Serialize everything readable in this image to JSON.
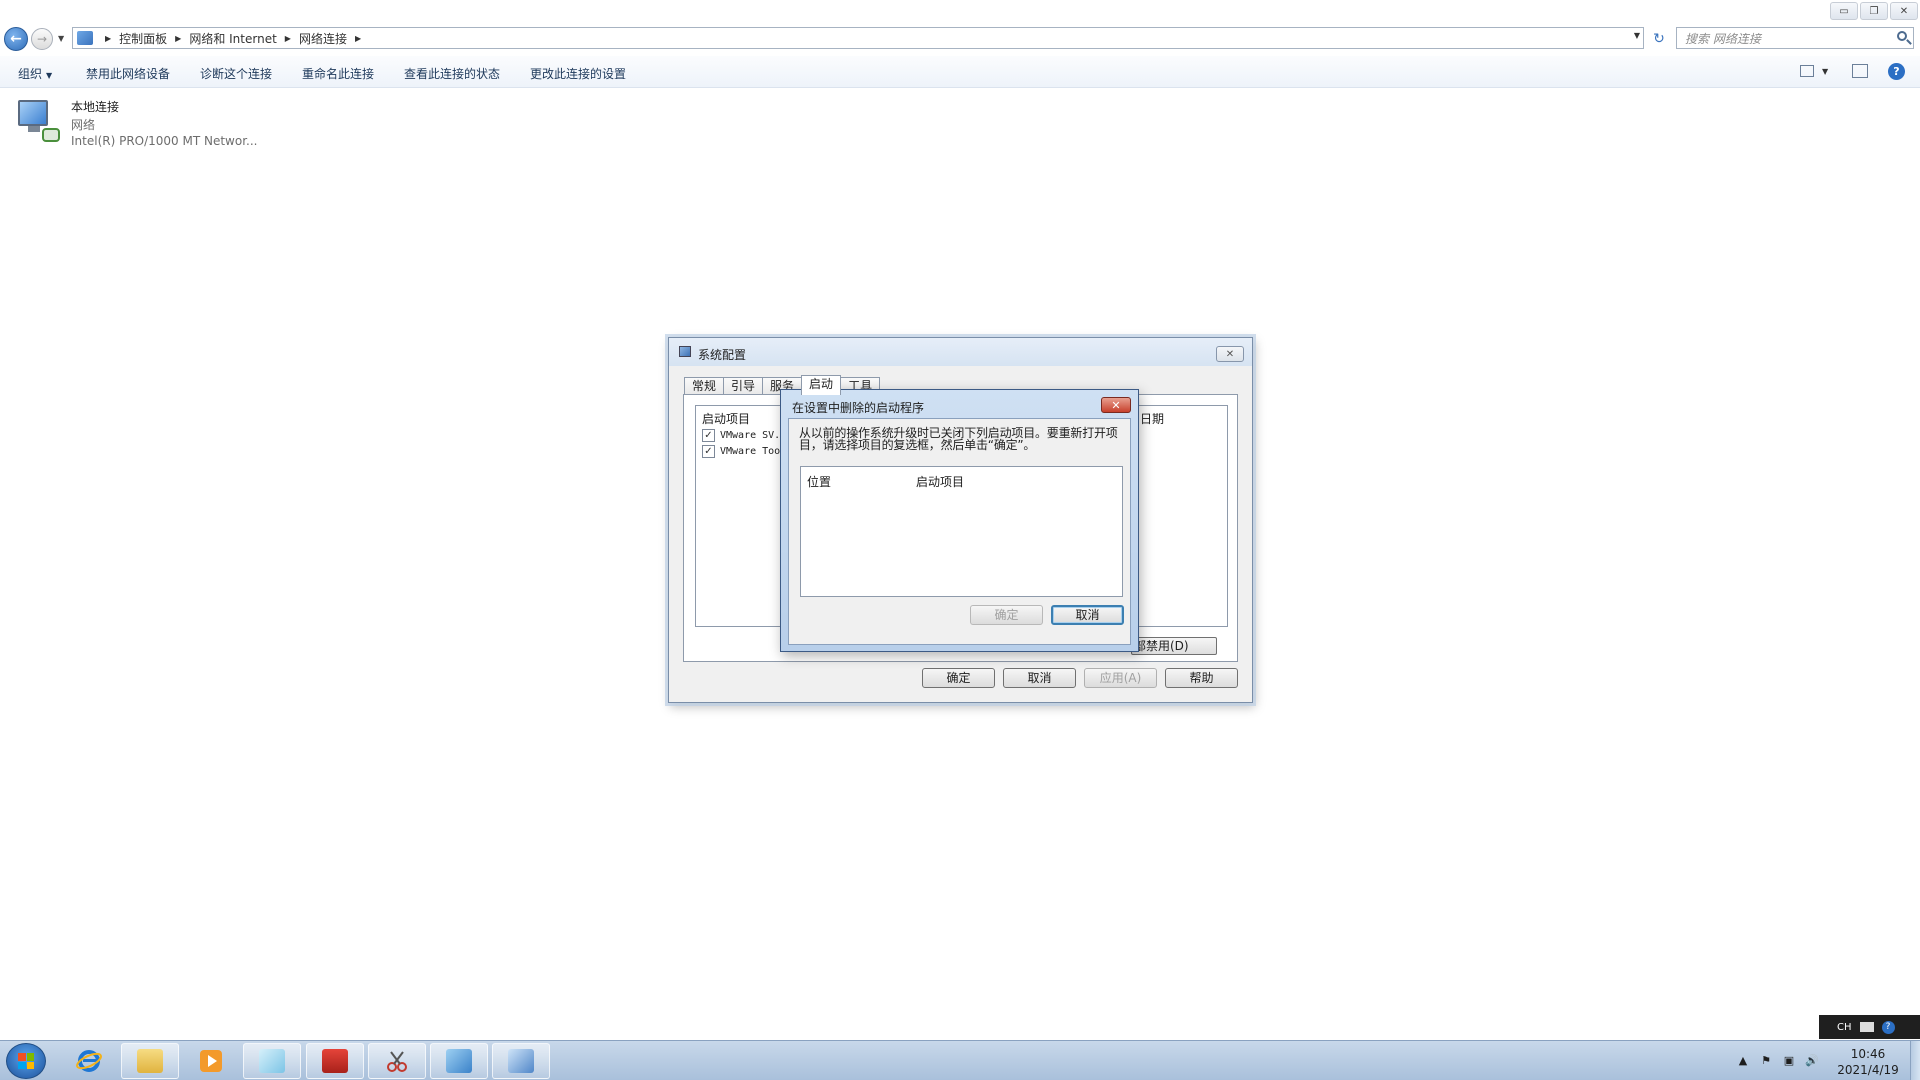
{
  "explorer": {
    "caption_buttons": {
      "minimize": "▭",
      "maximize": "❐",
      "close": "✕"
    },
    "breadcrumb": [
      "控制面板",
      "网络和 Internet",
      "网络连接"
    ],
    "search_placeholder": "搜索 网络连接",
    "commands": {
      "organize": "组织",
      "disable": "禁用此网络设备",
      "diagnose": "诊断这个连接",
      "rename": "重命名此连接",
      "status": "查看此连接的状态",
      "change": "更改此连接的设置"
    },
    "connection": {
      "name": "本地连接",
      "type": "网络",
      "adapter": "Intel(R) PRO/1000 MT Networ..."
    }
  },
  "msconfig": {
    "title": "系统配置",
    "tabs": [
      "常规",
      "引导",
      "服务",
      "启动",
      "工具"
    ],
    "active_tab": "启动",
    "columns": {
      "startup_item": "启动项目",
      "date_partial": "日期"
    },
    "rows": [
      {
        "label": "VMware SV...",
        "checked": true
      },
      {
        "label": "VMware Too",
        "checked": true
      }
    ],
    "disable_all_partial": "部禁用(D)",
    "buttons": {
      "ok": "确定",
      "cancel": "取消",
      "apply": "应用(A)",
      "help": "帮助"
    }
  },
  "remove_dialog": {
    "title": "在设置中删除的启动程序",
    "message": "从以前的操作系统升级时已关闭下列启动项目。要重新打开项目，请选择项目的复选框，然后单击“确定”。",
    "columns": {
      "location": "位置",
      "startup_item": "启动项目"
    },
    "buttons": {
      "ok": "确定",
      "cancel": "取消"
    },
    "ok_disabled": true
  },
  "taskbar": {
    "pinned_apps": [
      "internet-explorer",
      "windows-explorer",
      "media-player",
      "notepad",
      "toolbox",
      "snipping-tool",
      "control-panel",
      "system-config"
    ],
    "tray_lang": "CH",
    "clock_time": "10:46",
    "clock_date": "2021/4/19"
  }
}
